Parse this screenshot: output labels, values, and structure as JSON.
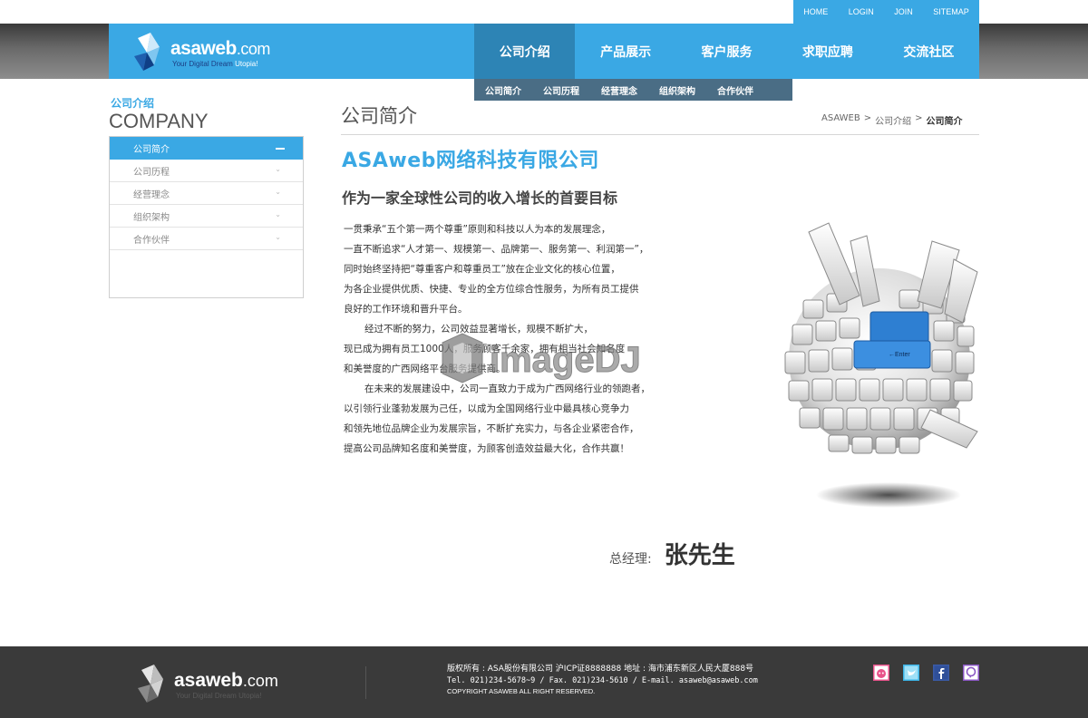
{
  "utility_nav": [
    "HOME",
    "LOGIN",
    "JOIN",
    "SITEMAP"
  ],
  "brand": {
    "name": "asaweb",
    "domain": ".com",
    "tagline": "Your Digital Dream",
    "tagline_tail": " Utopia!"
  },
  "main_nav": [
    {
      "label": "公司介绍",
      "active": true
    },
    {
      "label": "产品展示",
      "active": false
    },
    {
      "label": "客户服务",
      "active": false
    },
    {
      "label": "求职应聘",
      "active": false
    },
    {
      "label": "交流社区",
      "active": false
    }
  ],
  "sub_nav": [
    "公司简介",
    "公司历程",
    "经营理念",
    "组织架构",
    "合作伙伴"
  ],
  "sidebar": {
    "title_cn": "公司介绍",
    "title_en": "COMPANY",
    "items": [
      {
        "label": "公司简介",
        "active": true
      },
      {
        "label": "公司历程",
        "active": false
      },
      {
        "label": "经营理念",
        "active": false
      },
      {
        "label": "组织架构",
        "active": false
      },
      {
        "label": "合作伙伴",
        "active": false
      }
    ]
  },
  "content": {
    "page_title": "公司简介",
    "breadcrumb": [
      "ASAWEB",
      "公司介绍",
      "公司简介"
    ],
    "breadcrumb_sep": ">",
    "company_name": "ASAweb网络科技有限公司",
    "subheading": "作为一家全球性公司的收入增长的首要目标",
    "paragraphs": [
      "一贯秉承“五个第一两个尊重”原则和科技以人为本的发展理念，",
      "一直不断追求“人才第一、规模第一、品牌第一、服务第一、利润第一”，",
      "同时始终坚持把“尊重客户和尊重员工”放在企业文化的核心位置，",
      "为各企业提供优质、快捷、专业的全方位综合性服务，为所有员工提供",
      "良好的工作环境和晋升平台。",
      "经过不断的努力，公司效益显著增长，规模不断扩大，",
      "现已成为拥有员工1000人，服务顾客千余家，拥有相当社会知名度",
      "和美誉度的广西网络平台服务提供商。",
      "在未来的发展建设中，公司一直致力于成为广西网络行业的领跑者，",
      "以引领行业蓬勃发展为己任，以成为全国网络行业中最具核心竞争力",
      "和领先地位品牌企业为发展宗旨，不断扩充实力，与各企业紧密合作，",
      "提高公司品牌知名度和美誉度，为顾客创造效益最大化，合作共赢！"
    ],
    "indented_lines": [
      5,
      8
    ],
    "gm_label": "总经理:",
    "gm_name": "张先生",
    "image_key_label": "←Enter"
  },
  "watermark_text": "imageDJ",
  "footer": {
    "line1": "版权所有 : ASA股份有限公司 沪ICP证8888888   地址 : 海市浦东新区人民大厦888号",
    "line2": "Tel. 021)234-5678~9  / Fax. 021)234-5610  / E-mail. asaweb@asaweb.com",
    "line3": "COPYRIGHT ASAWEB ALL RIGHT RESERVED."
  },
  "social_icons": [
    "douban-icon",
    "twitter-icon",
    "facebook-icon",
    "chat-icon"
  ],
  "colors": {
    "accent": "#3aa8e4",
    "nav_active": "#2d84b5",
    "subnav": "#4a6d85",
    "footer": "#3a3a3a"
  }
}
